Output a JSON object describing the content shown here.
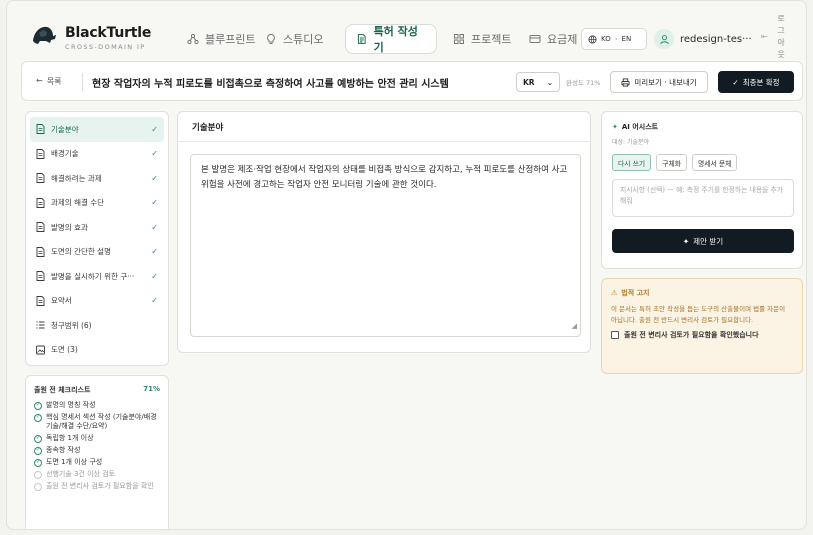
{
  "brand": {
    "name": "BlackTurtle",
    "subtitle": "CROSS-DOMAIN IP"
  },
  "nav": {
    "tabs": [
      {
        "label": "블루프린트",
        "icon": "network-icon"
      },
      {
        "label": "스튜디오",
        "icon": "lightbulb-icon"
      },
      {
        "label": "특허 작성기",
        "icon": "document-edit-icon"
      },
      {
        "label": "프로젝트",
        "icon": "grid-icon"
      },
      {
        "label": "요금제",
        "icon": "card-icon"
      }
    ],
    "active_tab": "특허 작성기",
    "lang": {
      "from": "KO",
      "sep": "›",
      "to": "EN"
    },
    "user": "redesign-tes···",
    "logout": "로그아웃"
  },
  "titlebar": {
    "back_label": "목록",
    "title": "현장 작업자의 누적 피로도를 비접촉으로 측정하여 사고를 예방하는 안전 관리 시스템",
    "lang_select": "KR",
    "progress_label": "완성도 71%",
    "preview_label": "미리보기 · 내보내기",
    "final_label": "최종본 확정"
  },
  "sections": [
    {
      "label": "기술분야",
      "done": true,
      "active": true
    },
    {
      "label": "배경기술",
      "done": true
    },
    {
      "label": "해결하려는 과제",
      "done": true
    },
    {
      "label": "과제의 해결 수단",
      "done": true
    },
    {
      "label": "발명의 효과",
      "done": true
    },
    {
      "label": "도면의 간단한 설명",
      "done": true
    },
    {
      "label": "발명을 실시하기 위한 구···",
      "done": true
    },
    {
      "label": "요약서",
      "done": true
    },
    {
      "label": "청구범위 (6)",
      "done": false
    },
    {
      "label": "도면 (3)",
      "done": false
    }
  ],
  "checklist": {
    "title": "출원 전 체크리스트",
    "percent": "71%",
    "items": [
      {
        "label": "발명의 명칭 작성",
        "done": true
      },
      {
        "label": "핵심 명세서 섹션 작성 (기술분야/배경기술/해결 수단/요약)",
        "done": true
      },
      {
        "label": "독립항 1개 이상",
        "done": true
      },
      {
        "label": "종속항 작성",
        "done": true
      },
      {
        "label": "도면 1개 이상 구성",
        "done": true
      },
      {
        "label": "선행기술 3건 이상 검토",
        "done": false
      },
      {
        "label": "출원 전 변리사 검토가 필요함을 확인",
        "done": false
      }
    ]
  },
  "editor": {
    "heading": "기술분야",
    "content": "본 발명은 제조·작업 현장에서 작업자의 상태를 비접촉 방식으로 감지하고, 누적 피로도를 산정하여 사고 위험을 사전에 경고하는 작업자 안전 모니터링 기술에 관한 것이다."
  },
  "ai": {
    "title": "AI 어시스트",
    "target": "대상: 기술분야",
    "modes": [
      "다시 쓰기",
      "구체화",
      "명세서 문체"
    ],
    "selected_mode": "다시 쓰기",
    "placeholder": "지시사항 (선택) — 예: 측정 주기를 한정하는 내용을 추가해줘",
    "suggest_label": "제안 받기"
  },
  "legal": {
    "title": "법적 고지",
    "body": "이 문서는 특허 초안 작성을 돕는 도구의 산출물이며 법률 자문이 아닙니다. 출원 전 반드시 변리사 검토가 필요합니다.",
    "confirm_label": "출원 전 변리사 검토가 필요함을 확인했습니다"
  },
  "colors": {
    "accent": "#17654d",
    "accent_light": "#e7f3ee",
    "dark_button": "#121a22",
    "warning_bg": "#fbf3e4",
    "warning_text": "#b7791f"
  }
}
